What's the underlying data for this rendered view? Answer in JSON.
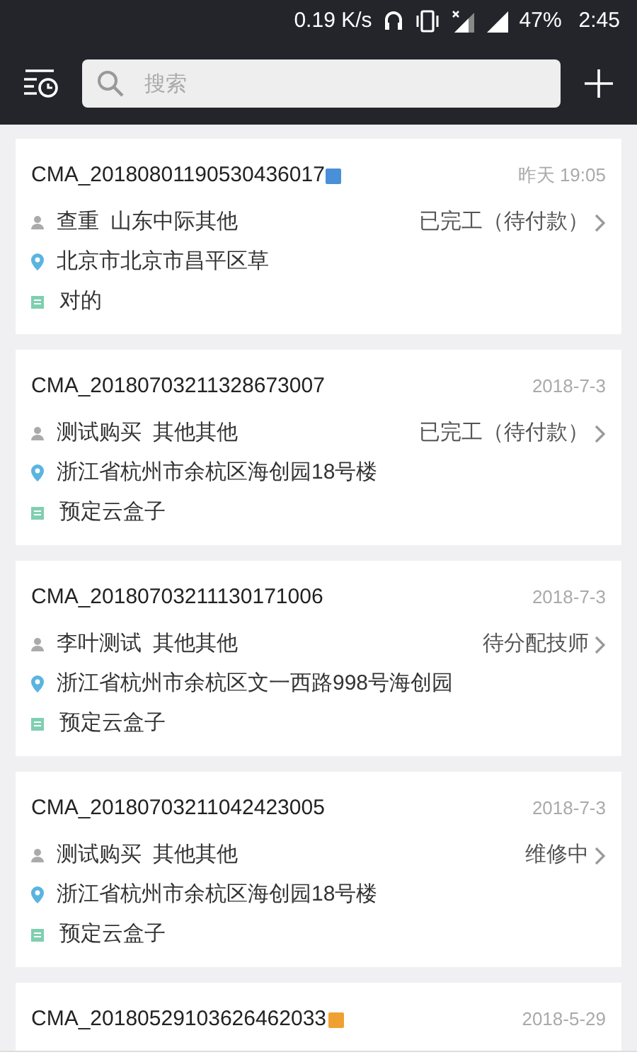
{
  "status_bar": {
    "speed": "0.19 K/s",
    "battery": "47%",
    "time": "2:45"
  },
  "header": {
    "search": {
      "placeholder": "搜索"
    }
  },
  "orders": [
    {
      "id": "CMA_20180801190530436017",
      "color": "#4a90d9",
      "time": "昨天 19:05",
      "person": "查重",
      "category": "山东中际其他",
      "status": "已完工（待付款）",
      "address": "北京市北京市昌平区草",
      "note": "对的"
    },
    {
      "id": "CMA_20180703211328673007",
      "time": "2018-7-3",
      "person": "测试购买",
      "category": "其他其他",
      "status": "已完工（待付款）",
      "address": "浙江省杭州市余杭区海创园18号楼",
      "note": "预定云盒子"
    },
    {
      "id": "CMA_20180703211130171006",
      "time": "2018-7-3",
      "person": "李叶测试",
      "category": "其他其他",
      "status": "待分配技师",
      "address": "浙江省杭州市余杭区文一西路998号海创园",
      "note": "预定云盒子"
    },
    {
      "id": "CMA_20180703211042423005",
      "time": "2018-7-3",
      "person": "测试购买",
      "category": "其他其他",
      "status": "维修中",
      "address": "浙江省杭州市余杭区海创园18号楼",
      "note": "预定云盒子"
    },
    {
      "id": "CMA_20180529103626462033",
      "color": "#f0a030",
      "time": "2018-5-29"
    }
  ]
}
